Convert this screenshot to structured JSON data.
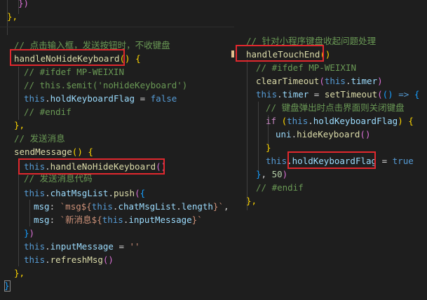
{
  "colors": {
    "highlight_box": "#e0282e",
    "keyword": "#569cd6",
    "function": "#dcdcaa",
    "property": "#9cdcfe",
    "comment": "#6a9955",
    "string": "#ce9178",
    "number": "#b5cea8",
    "control": "#c586c0"
  },
  "left_editor": {
    "line1": "})",
    "line2": "},",
    "line3_comment": "// 点击输入框，发送按钮时，不收键盘",
    "line4_fn": "handleNoHideKeyboard",
    "line5": "// #ifdef MP-WEIXIN",
    "line6": "// this.$emit('noHideKeyboard')",
    "line7_prop": "holdKeyboardFlag",
    "line7_val": "false",
    "line8": "// #endif",
    "line9": "},",
    "line10_comment": "// 发送消息",
    "line11_fn": "sendMessage",
    "line12_call": "handleNoHideKeyboard",
    "line13_comment": "// 发送消息代码",
    "line14_prop": "chatMsgList",
    "line14_fn": "push",
    "line15_key": "msg",
    "line15_str1": "`msg${",
    "line15_prop": "chatMsgList",
    "line15_len": "length",
    "line15_str2": "}`",
    "line16_key": "msg",
    "line16_str1": "`新消息${",
    "line16_prop": "inputMessage",
    "line16_str2": "}`",
    "line18_prop": "inputMessage",
    "line18_str": "''",
    "line19_fn": "refreshMsg",
    "line20": "},"
  },
  "right_editor": {
    "line1_comment": "// 针对小程序键盘收起问题处理",
    "line2_fn": "handleTouchEnd",
    "line3": "// #ifdef MP-WEIXIN",
    "line4_fn": "clearTimeout",
    "line4_prop": "timer",
    "line5_prop": "timer",
    "line5_fn": "setTimeout",
    "line6_comment": "// 键盘弹出时点击界面则关闭键盘",
    "line7_prop": "holdKeyboardFlag",
    "line8_obj": "uni",
    "line8_fn": "hideKeyboard",
    "line10_prop": "holdKeyboardFlag",
    "line10_val": "true",
    "line11_num": "50",
    "line12": "// #endif",
    "line13": "},"
  }
}
